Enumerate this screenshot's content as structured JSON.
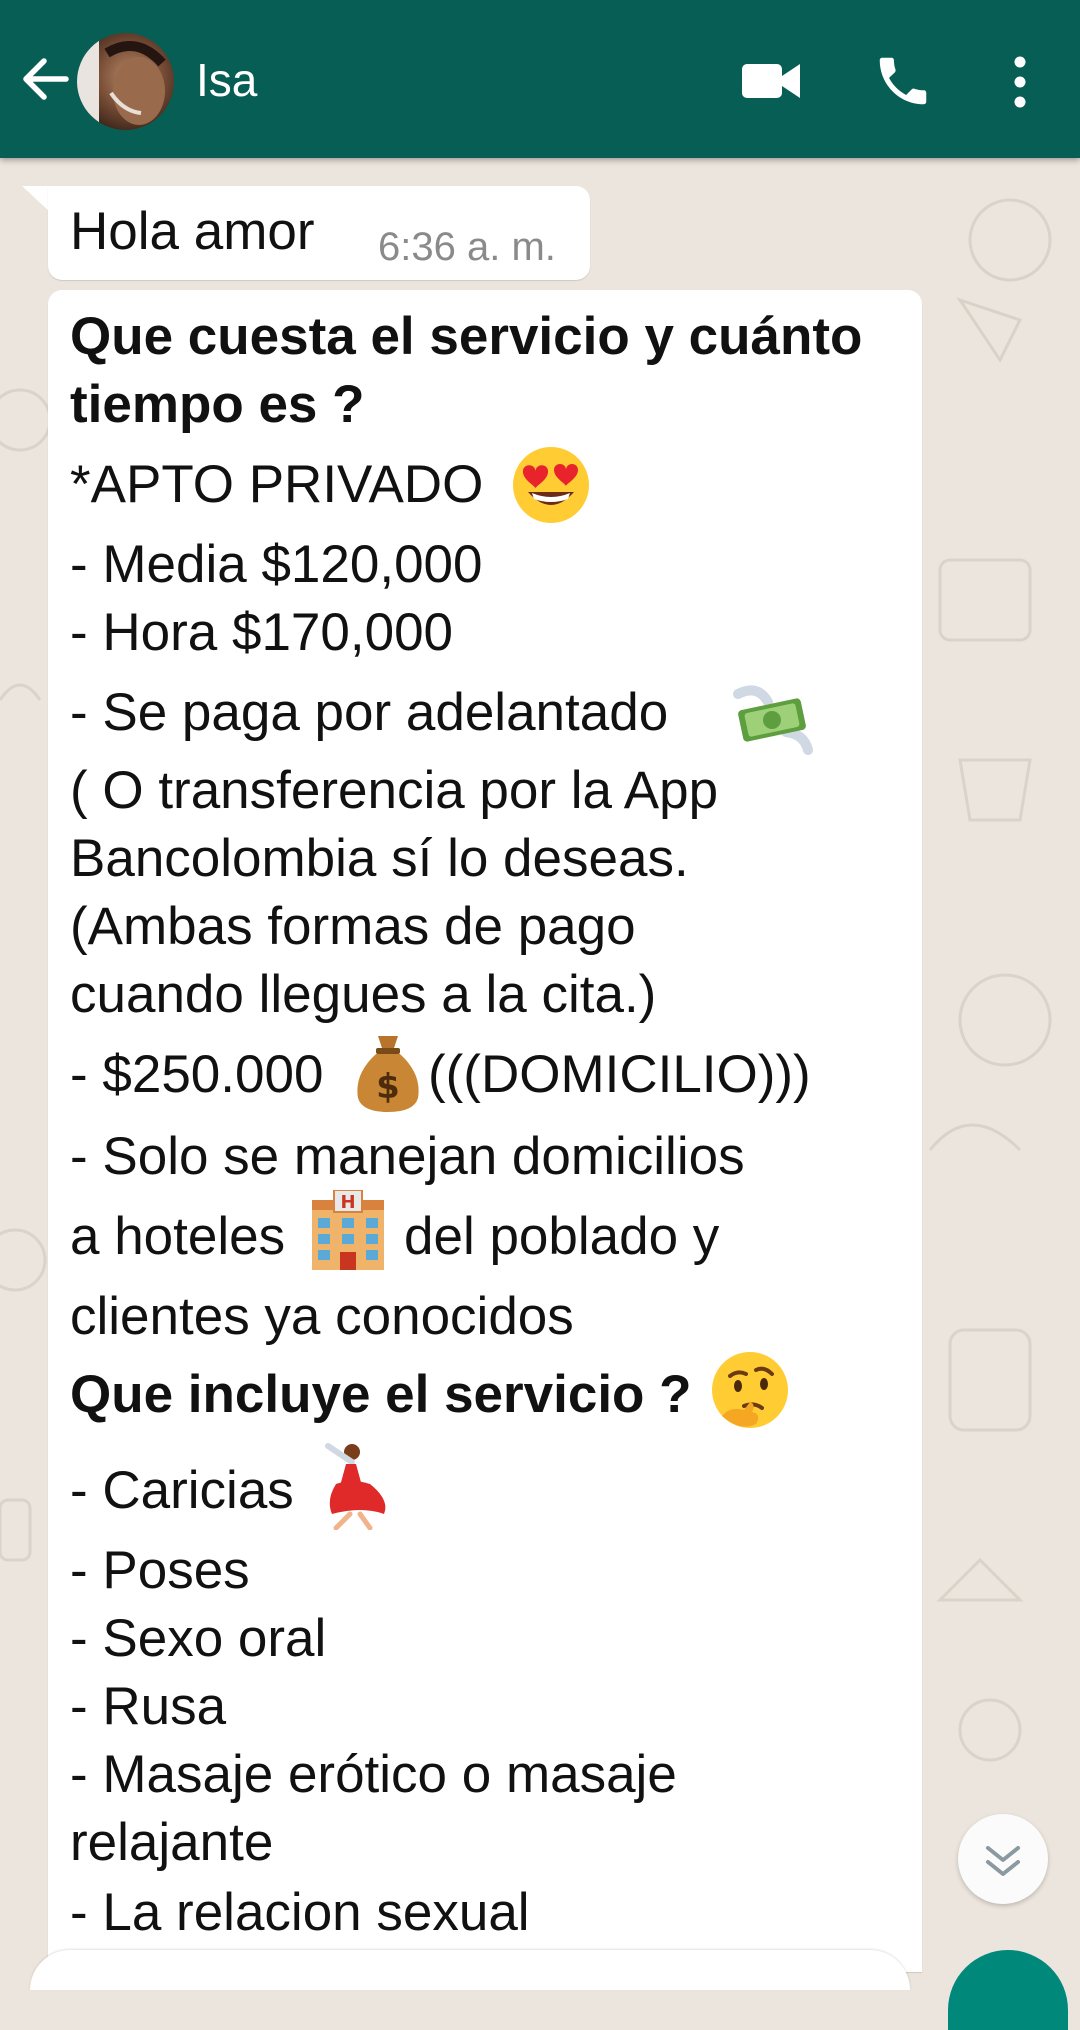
{
  "header": {
    "contact_name": "Isa",
    "colors": {
      "bar": "#075e54",
      "icons": "#ffffff"
    },
    "icons": [
      "back-arrow-icon",
      "avatar",
      "video-call-icon",
      "voice-call-icon",
      "more-options-icon"
    ]
  },
  "messages": [
    {
      "text": "Hola amor",
      "time": "6:36 a. m."
    },
    {
      "lines": [
        "Que cuesta el servicio y cuánto",
        "tiempo es ?",
        "*APTO PRIVADO",
        "- Media $120,000",
        "- Hora $170,000",
        "- Se paga por adelantado",
        "( O transferencia por la App",
        "Bancolombia sí lo deseas.",
        "(Ambas formas de pago",
        "cuando llegues a la cita.)",
        "- $250.000",
        "(((DOMICILIO)))",
        "- Solo se manejan domicilios",
        "a hoteles",
        "del poblado y",
        "clientes ya conocidos",
        "Que incluye el servicio ?",
        "- Caricias",
        "- Poses",
        "- Sexo oral",
        "- Rusa",
        "- Masaje erótico o masaje",
        "relajante",
        "- La relacion sexual"
      ],
      "emojis": [
        "heart-eyes-emoji",
        "money-wings-emoji",
        "money-bag-emoji",
        "hotel-emoji",
        "thinking-emoji",
        "dancer-emoji"
      ]
    }
  ],
  "scroll_button": {
    "icon": "double-chevron-down-icon"
  }
}
